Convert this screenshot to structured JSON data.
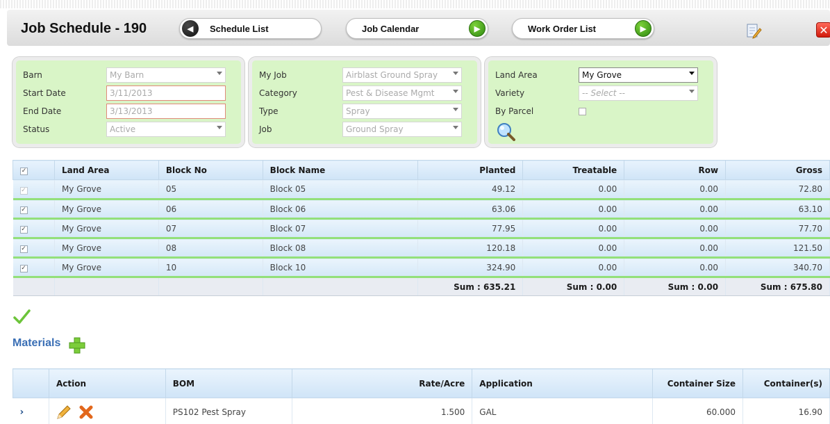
{
  "header": {
    "title": "Job Schedule - 190",
    "nav": {
      "schedule_list": "Schedule List",
      "job_calendar": "Job Calendar",
      "work_order_list": "Work Order List"
    }
  },
  "filters": {
    "left": {
      "barn_label": "Barn",
      "barn_value": "My Barn",
      "start_label": "Start Date",
      "start_value": "3/11/2013",
      "end_label": "End Date",
      "end_value": "3/13/2013",
      "status_label": "Status",
      "status_value": "Active"
    },
    "middle": {
      "myjob_label": "My Job",
      "myjob_value": "Airblast Ground Spray",
      "category_label": "Category",
      "category_value": "Pest & Disease Mgmt",
      "type_label": "Type",
      "type_value": "Spray",
      "job_label": "Job",
      "job_value": "Ground Spray"
    },
    "right": {
      "land_label": "Land Area",
      "land_value": "My Grove",
      "variety_label": "Variety",
      "variety_value": "-- Select --",
      "parcel_label": "By Parcel"
    }
  },
  "blocks": {
    "headers": [
      "Land Area",
      "Block No",
      "Block Name",
      "Planted",
      "Treatable",
      "Row",
      "Gross"
    ],
    "rows": [
      {
        "land": "My Grove",
        "no": "05",
        "name": "Block 05",
        "planted": "49.12",
        "treatable": "0.00",
        "row": "0.00",
        "gross": "72.80"
      },
      {
        "land": "My Grove",
        "no": "06",
        "name": "Block 06",
        "planted": "63.06",
        "treatable": "0.00",
        "row": "0.00",
        "gross": "63.10"
      },
      {
        "land": "My Grove",
        "no": "07",
        "name": "Block 07",
        "planted": "77.95",
        "treatable": "0.00",
        "row": "0.00",
        "gross": "77.70"
      },
      {
        "land": "My Grove",
        "no": "08",
        "name": "Block 08",
        "planted": "120.18",
        "treatable": "0.00",
        "row": "0.00",
        "gross": "121.50"
      },
      {
        "land": "My Grove",
        "no": "10",
        "name": "Block 10",
        "planted": "324.90",
        "treatable": "0.00",
        "row": "0.00",
        "gross": "340.70"
      }
    ],
    "sums": {
      "planted": "Sum : 635.21",
      "treatable": "Sum : 0.00",
      "row": "Sum : 0.00",
      "gross": "Sum : 675.80"
    }
  },
  "materials": {
    "title": "Materials",
    "headers": [
      "Action",
      "BOM",
      "Rate/Acre",
      "Application",
      "Container Size",
      "Container(s)"
    ],
    "rows": [
      {
        "chevron": "›",
        "bom": "PS102 Pest Spray",
        "rate": "1.500",
        "application": "GAL",
        "container_size": "60.000",
        "containers": "16.90"
      }
    ]
  },
  "colors": {
    "panel_bg": "#d9f5c7",
    "row_separator": "#93e07a",
    "accent_blue": "#3a6fb5",
    "close_red": "#d11b0c"
  },
  "icons": [
    "arrow-left-icon",
    "arrow-right-icon",
    "edit-icon",
    "close-icon",
    "search-icon",
    "checkmark-icon",
    "plus-icon",
    "pencil-icon",
    "delete-x-icon",
    "chevron-right-icon"
  ]
}
